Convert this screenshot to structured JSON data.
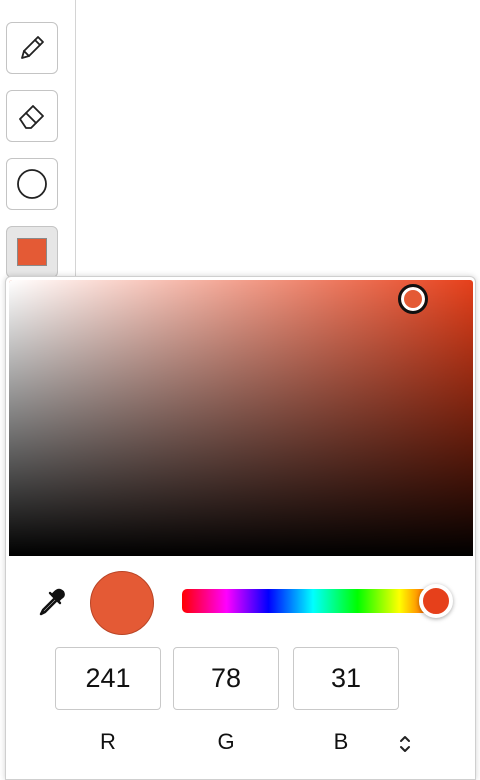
{
  "toolbar": {
    "tools": [
      {
        "name": "pencil",
        "icon": "pencil-icon"
      },
      {
        "name": "eraser",
        "icon": "eraser-icon"
      },
      {
        "name": "circle",
        "icon": "circle-icon"
      },
      {
        "name": "color",
        "icon": "color-swatch",
        "active": true
      }
    ]
  },
  "color_picker": {
    "current_color": "#e45a35",
    "hue_base": "#e6401b",
    "saturation_value": {
      "saturation": 0.87,
      "brightness": 0.93
    },
    "hue_level": 0.97,
    "eyedropper_icon": "eyedropper-icon",
    "rgb": {
      "r": "241",
      "g": "78",
      "b": "31"
    },
    "labels": {
      "r": "R",
      "g": "G",
      "b": "B"
    },
    "mode_toggle_icon": "chevron-up-down-icon"
  }
}
